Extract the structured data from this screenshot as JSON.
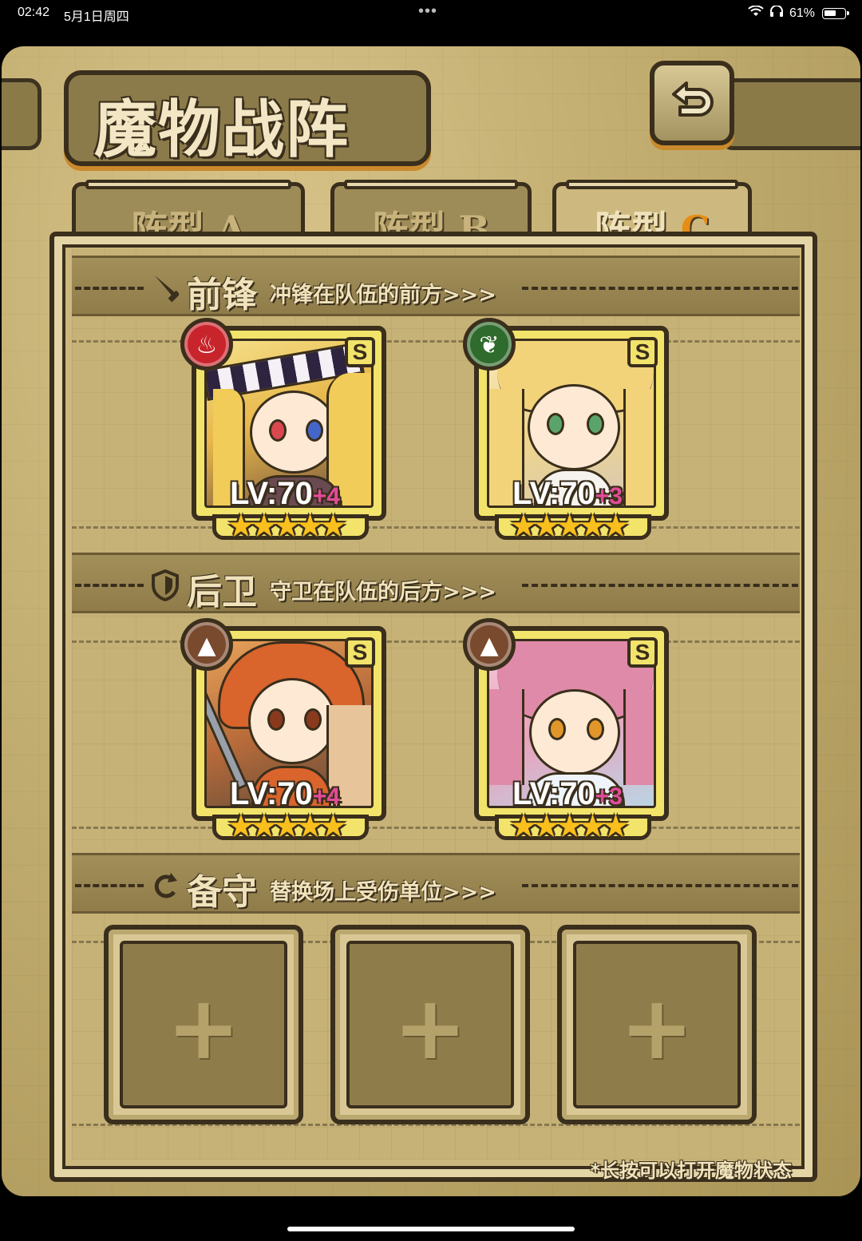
{
  "status_bar": {
    "time": "02:42",
    "date": "5月1日周四",
    "dots": "•••",
    "battery_percent": "61%",
    "battery_level": 0.61
  },
  "game": {
    "title": "魔物战阵",
    "back_icon": "return-arrow-icon",
    "tabs": [
      {
        "label": "阵型",
        "letter": "A",
        "active": false
      },
      {
        "label": "阵型",
        "letter": "B",
        "active": false
      },
      {
        "label": "阵型",
        "letter": "C",
        "active": true
      }
    ],
    "sections": {
      "front": {
        "title": "前锋",
        "desc": "冲锋在队伍的前方>>>",
        "icon": "sword-icon"
      },
      "rear": {
        "title": "后卫",
        "desc": "守卫在队伍的后方>>>",
        "icon": "shield-icon"
      },
      "reserve": {
        "title": "备守",
        "desc": "替换场上受伤单位>>>",
        "icon": "swap-icon"
      }
    },
    "front_units": [
      {
        "element": "fire",
        "element_color": "#c8242c",
        "rank": "S",
        "level": "LV:70",
        "bonus": "+4",
        "stars": 5
      },
      {
        "element": "nature",
        "element_color": "#2f6b2c",
        "rank": "S",
        "level": "LV:70",
        "bonus": "+3",
        "stars": 5
      }
    ],
    "rear_units": [
      {
        "element": "earth",
        "element_color": "#7a4a2e",
        "rank": "S",
        "level": "LV:70",
        "bonus": "+4",
        "stars": 5
      },
      {
        "element": "earth",
        "element_color": "#7a4a2e",
        "rank": "S",
        "level": "LV:70",
        "bonus": "+3",
        "stars": 5
      }
    ],
    "reserve_slots": [
      "+",
      "+",
      "+"
    ],
    "hint": "*长按可以打开魔物状态"
  },
  "colors": {
    "frame_dark": "#3a2e1c",
    "parchment": "#c6b277",
    "card_gold": "#f2e36b",
    "star": "#f9bf1c",
    "bonus_pink": "#e24b98",
    "active_letter": "#e68d16"
  }
}
